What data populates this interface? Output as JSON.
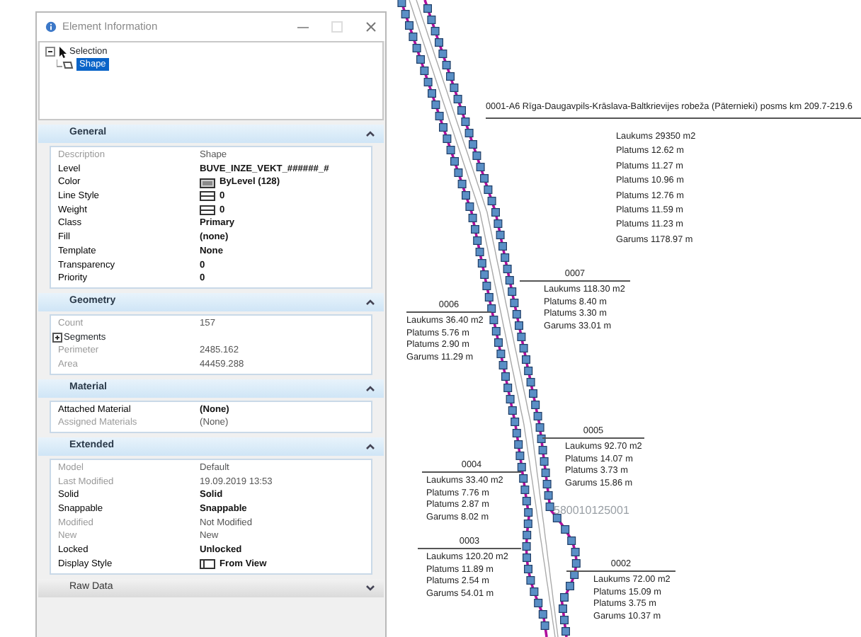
{
  "panel": {
    "title": "Element Information",
    "tree": {
      "label": "Selection",
      "expanded": true,
      "children": [
        {
          "label": "Shape",
          "selected": true
        }
      ]
    },
    "sections": [
      {
        "title": "General",
        "expanded": true,
        "rows": [
          {
            "label": "Description",
            "value": "Shape",
            "read_only": true,
            "bold": false
          },
          {
            "label": "Level",
            "value": "BUVE_INZE_VEKT_######_#",
            "read_only": false,
            "bold": true
          },
          {
            "label": "Color",
            "value": "ByLevel (128)",
            "read_only": false,
            "bold": true,
            "kind": "color"
          },
          {
            "label": "Line Style",
            "value": "0",
            "read_only": false,
            "bold": true,
            "kind": "line"
          },
          {
            "label": "Weight",
            "value": "0",
            "read_only": false,
            "bold": true,
            "kind": "line"
          },
          {
            "label": "Class",
            "value": "Primary",
            "read_only": false,
            "bold": true
          },
          {
            "label": "Fill",
            "value": "(none)",
            "read_only": false,
            "bold": true
          },
          {
            "label": "Template",
            "value": "None",
            "read_only": false,
            "bold": true
          },
          {
            "label": "Transparency",
            "value": "0",
            "read_only": false,
            "bold": true
          },
          {
            "label": "Priority",
            "value": "0",
            "read_only": false,
            "bold": true
          }
        ]
      },
      {
        "title": "Geometry",
        "expanded": true,
        "rows": [
          {
            "label": "Count",
            "value": "157",
            "read_only": true,
            "bold": false
          },
          {
            "label": "Segments",
            "kind": "group",
            "expanded": false
          },
          {
            "label": "Perimeter",
            "value": "2485.162",
            "read_only": true,
            "bold": false
          },
          {
            "label": "Area",
            "value": "44459.288",
            "read_only": true,
            "bold": false
          }
        ]
      },
      {
        "title": "Material",
        "expanded": true,
        "rows": [
          {
            "label": "Attached Material",
            "value": "(None)",
            "read_only": false,
            "bold": true
          },
          {
            "label": "Assigned Materials",
            "value": "(None)",
            "read_only": true,
            "bold": false
          }
        ]
      },
      {
        "title": "Extended",
        "expanded": true,
        "rows": [
          {
            "label": "Model",
            "value": "Default",
            "read_only": true,
            "bold": false
          },
          {
            "label": "Last Modified",
            "value": "19.09.2019 13:53",
            "read_only": true,
            "bold": false
          },
          {
            "label": "Solid",
            "value": "Solid",
            "read_only": false,
            "bold": true
          },
          {
            "label": "Snappable",
            "value": "Snappable",
            "read_only": false,
            "bold": true
          },
          {
            "label": "Modified",
            "value": "Not Modified",
            "read_only": true,
            "bold": false
          },
          {
            "label": "New",
            "value": "New",
            "read_only": true,
            "bold": false
          },
          {
            "label": "Locked",
            "value": "Unlocked",
            "read_only": false,
            "bold": true
          },
          {
            "label": "Display Style",
            "value": "From View",
            "read_only": false,
            "bold": true,
            "kind": "view"
          }
        ]
      },
      {
        "title": "Raw Data",
        "expanded": false
      }
    ]
  },
  "drawing": {
    "labels": [
      {
        "title": "0001-A6 Rīga-Daugavpils-Krāslava-Baltkrievijes robeža (Pāternieki) posms km 209.7-219.6",
        "lines": [
          "Laukums 29350 m2",
          "Platums 12.62 m",
          "Platums 11.27 m",
          "Platums 10.96 m",
          "Platums 12.76 m",
          "Platums 11.59 m",
          "Platums 11.23 m",
          "Garums 1178.97 m"
        ]
      },
      {
        "title": "0007",
        "lines": [
          "Laukums 118.30 m2",
          "Platums 8.40 m",
          "Platums 3.30 m",
          "Garums 33.01 m"
        ]
      },
      {
        "title": "0006",
        "lines": [
          "Laukums 36.40 m2",
          "Platums 5.76 m",
          "Platums 2.90 m",
          "Garums 11.29 m"
        ]
      },
      {
        "title": "0005",
        "lines": [
          "Laukums 92.70 m2",
          "Platums 14.07 m",
          "Platums 3.73 m",
          "Garums 15.86 m"
        ]
      },
      {
        "title": "0004",
        "lines": [
          "Laukums 33.40 m2",
          "Platums 7.76 m",
          "Platums 2.87 m",
          "Garums 8.02 m"
        ]
      },
      {
        "title": "0003",
        "lines": [
          "Laukums 120.20 m2",
          "Platums 11.89 m",
          "Platums 2.54 m",
          "Garums 54.01 m"
        ]
      },
      {
        "title": "0002",
        "lines": [
          "Laukums 72.00 m2",
          "Platums 15.09 m",
          "Platums 3.75 m",
          "Garums 10.37 m"
        ]
      }
    ],
    "stamp": "580010125001"
  }
}
